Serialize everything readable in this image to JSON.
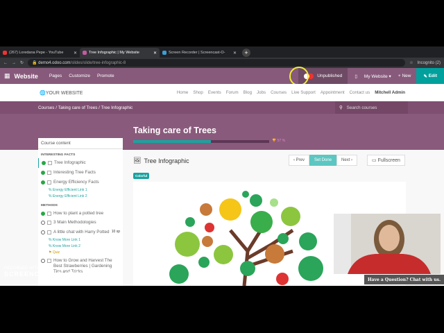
{
  "browser": {
    "tabs": [
      {
        "label": "(267) Loredana Pepe - YouTube",
        "icon": "youtube-icon",
        "color": "#e33"
      },
      {
        "label": "Tree Infographic | My Website",
        "icon": "odoo-icon",
        "color": "#c55aa0"
      },
      {
        "label": "Screen Recorder | Screencast-O-",
        "icon": "screencast-icon",
        "color": "#3a9fd6"
      }
    ],
    "url_host": "demo4.odoo.com",
    "url_path": "/slides/slide/tree-infographic-8",
    "profile": "Incognito (2)"
  },
  "odoo_bar": {
    "brand": "Website",
    "menu": [
      "Pages",
      "Customize",
      "Promote"
    ],
    "publish_status": "Unpublished",
    "website": "My Website",
    "new": "New",
    "edit": "Edit"
  },
  "site": {
    "logo": "YOUR WEBSITE",
    "links": [
      "Home",
      "Shop",
      "Events",
      "Forum",
      "Blog",
      "Jobs",
      "Courses",
      "Live Support",
      "Appointment",
      "Contact us"
    ],
    "user": "Mitchell Admin"
  },
  "breadcrumb": [
    "Courses",
    "Taking care of Trees",
    "Tree Infographic"
  ],
  "search_placeholder": "Search courses",
  "course": {
    "title": "Taking care of Trees",
    "progress_pct": 57,
    "progress_label": "57 %"
  },
  "sidebar": {
    "header": "Course content",
    "sections": [
      {
        "title": "INTERESTING FACTS",
        "items": [
          {
            "label": "Tree Infographic",
            "done": true,
            "active": true
          },
          {
            "label": "Interesting Tree Facts",
            "done": true
          },
          {
            "label": "Energy Efficiency Facts",
            "done": true,
            "links": [
              "Energy Efficient Link 1",
              "Energy Efficient Link 2"
            ]
          }
        ]
      },
      {
        "title": "METHODS",
        "items": [
          {
            "label": "How to plant a potted tree",
            "done": true
          },
          {
            "label": "3 Main Methodologies",
            "done": false
          },
          {
            "label": "A little chat with Harry Potted",
            "done": false,
            "xp": "10 xp",
            "links": [
              "Know More Link 1",
              "Know More Link 2"
            ],
            "quiz": "Quiz"
          },
          {
            "label": "How to Grow and Harvest The Best Strawberries | Gardening Tips and Tricks",
            "done": false
          }
        ]
      }
    ]
  },
  "slide": {
    "title": "Tree Infographic",
    "tag": "Colorful",
    "prev": "Prev",
    "set_done": "Set Done",
    "next": "Next",
    "fullscreen": "Fullscreen"
  },
  "chat": "Have a Question? Chat with us.",
  "watermark": {
    "line1": "RECORDED WITH",
    "line2": "SCREENCAST-O-MATIC"
  }
}
